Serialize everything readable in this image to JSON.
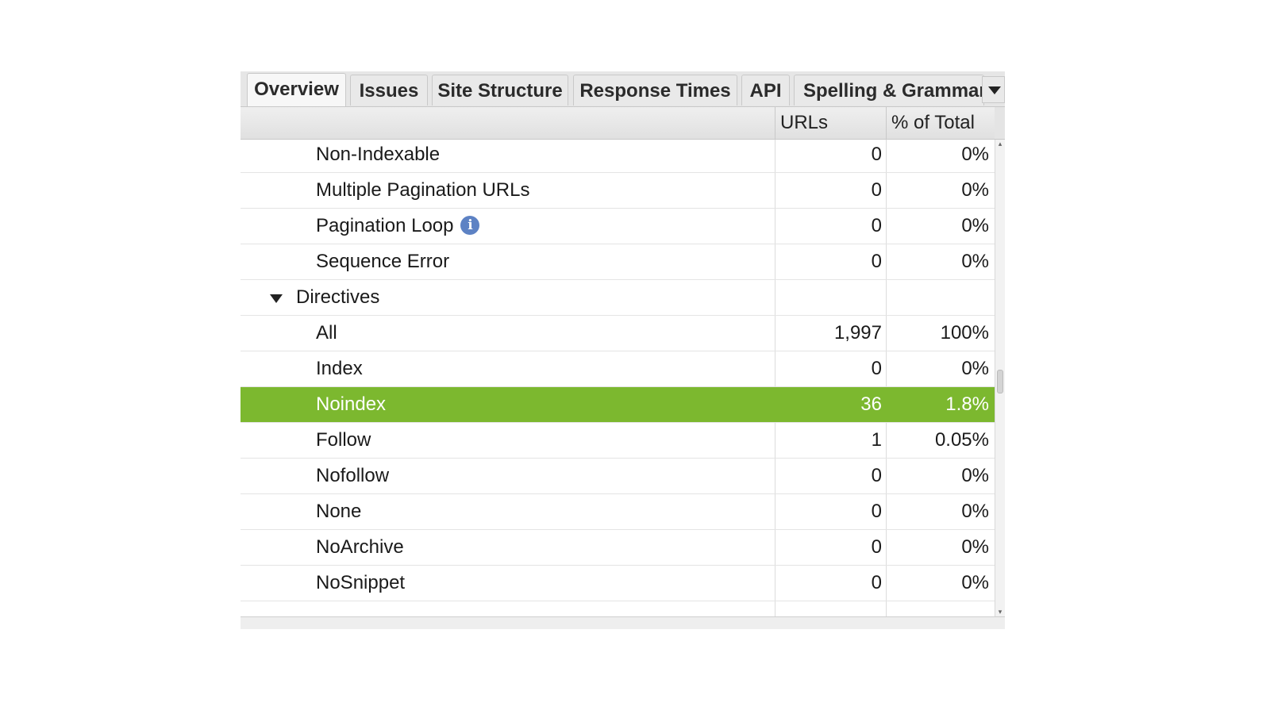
{
  "tabs": [
    {
      "label": "Overview",
      "active": true
    },
    {
      "label": "Issues"
    },
    {
      "label": "Site Structure"
    },
    {
      "label": "Response Times"
    },
    {
      "label": "API"
    },
    {
      "label": "Spelling & Grammar"
    }
  ],
  "columns": {
    "label": "",
    "urls": "URLs",
    "pct": "% of Total"
  },
  "rows": [
    {
      "label": "Non-Indexable",
      "urls": "0",
      "pct": "0%"
    },
    {
      "label": "Multiple Pagination URLs",
      "urls": "0",
      "pct": "0%"
    },
    {
      "label": "Pagination Loop",
      "urls": "0",
      "pct": "0%",
      "info_icon": "info-icon"
    },
    {
      "label": "Sequence Error",
      "urls": "0",
      "pct": "0%"
    },
    {
      "label": "Directives",
      "urls": "",
      "pct": "",
      "group": true,
      "expanded": true
    },
    {
      "label": "All",
      "urls": "1,997",
      "pct": "100%"
    },
    {
      "label": "Index",
      "urls": "0",
      "pct": "0%"
    },
    {
      "label": "Noindex",
      "urls": "36",
      "pct": "1.8%",
      "selected": true
    },
    {
      "label": "Follow",
      "urls": "1",
      "pct": "0.05%"
    },
    {
      "label": "Nofollow",
      "urls": "0",
      "pct": "0%"
    },
    {
      "label": "None",
      "urls": "0",
      "pct": "0%"
    },
    {
      "label": "NoArchive",
      "urls": "0",
      "pct": "0%"
    },
    {
      "label": "NoSnippet",
      "urls": "0",
      "pct": "0%"
    }
  ],
  "colors": {
    "selected_row": "#7cb82f",
    "info_icon": "#5d82c4"
  },
  "icons": {
    "tab_overflow": "chevron-down-icon",
    "info": "info-icon",
    "expander": "caret-down-icon"
  }
}
